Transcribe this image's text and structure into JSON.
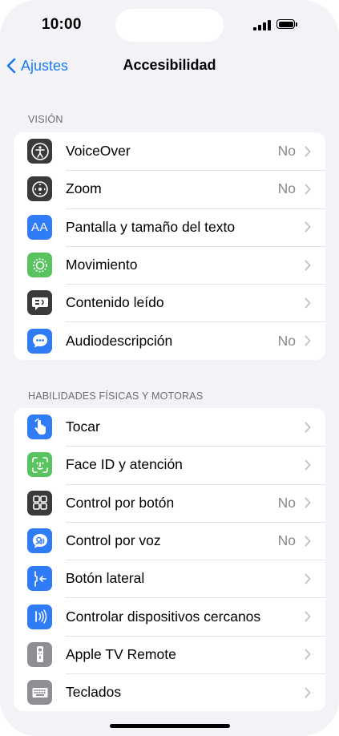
{
  "status_bar": {
    "time": "10:00"
  },
  "nav": {
    "back_label": "Ajustes",
    "title": "Accesibilidad"
  },
  "vision": {
    "header": "VISIÓN",
    "items": [
      {
        "label": "VoiceOver",
        "value": "No",
        "icon": "voiceover-icon",
        "color": "#3a3a3c"
      },
      {
        "label": "Zoom",
        "value": "No",
        "icon": "zoom-icon",
        "color": "#3a3a3c"
      },
      {
        "label": "Pantalla y tamaño del texto",
        "value": "",
        "icon": "text-size-icon",
        "color": "#2f7cf6"
      },
      {
        "label": "Movimiento",
        "value": "",
        "icon": "motion-icon",
        "color": "#58c35f"
      },
      {
        "label": "Contenido leído",
        "value": "",
        "icon": "spoken-content-icon",
        "color": "#3a3a3c"
      },
      {
        "label": "Audiodescripción",
        "value": "No",
        "icon": "audio-description-icon",
        "color": "#2f7cf6"
      }
    ]
  },
  "physical": {
    "header": "HABILIDADES FÍSICAS Y MOTORAS",
    "items": [
      {
        "label": "Tocar",
        "value": "",
        "icon": "touch-icon",
        "color": "#2f7cf6"
      },
      {
        "label": "Face ID y atención",
        "value": "",
        "icon": "face-id-icon",
        "color": "#58c35f"
      },
      {
        "label": "Control por botón",
        "value": "No",
        "icon": "switch-control-icon",
        "color": "#3a3a3c"
      },
      {
        "label": "Control por voz",
        "value": "No",
        "icon": "voice-control-icon",
        "color": "#2f7cf6"
      },
      {
        "label": "Botón lateral",
        "value": "",
        "icon": "side-button-icon",
        "color": "#2f7cf6"
      },
      {
        "label": "Controlar dispositivos cercanos",
        "value": "",
        "icon": "nearby-devices-icon",
        "color": "#2f7cf6"
      },
      {
        "label": "Apple TV Remote",
        "value": "",
        "icon": "tv-remote-icon",
        "color": "#8e8e93"
      },
      {
        "label": "Teclados",
        "value": "",
        "icon": "keyboard-icon",
        "color": "#8e8e93"
      }
    ]
  }
}
